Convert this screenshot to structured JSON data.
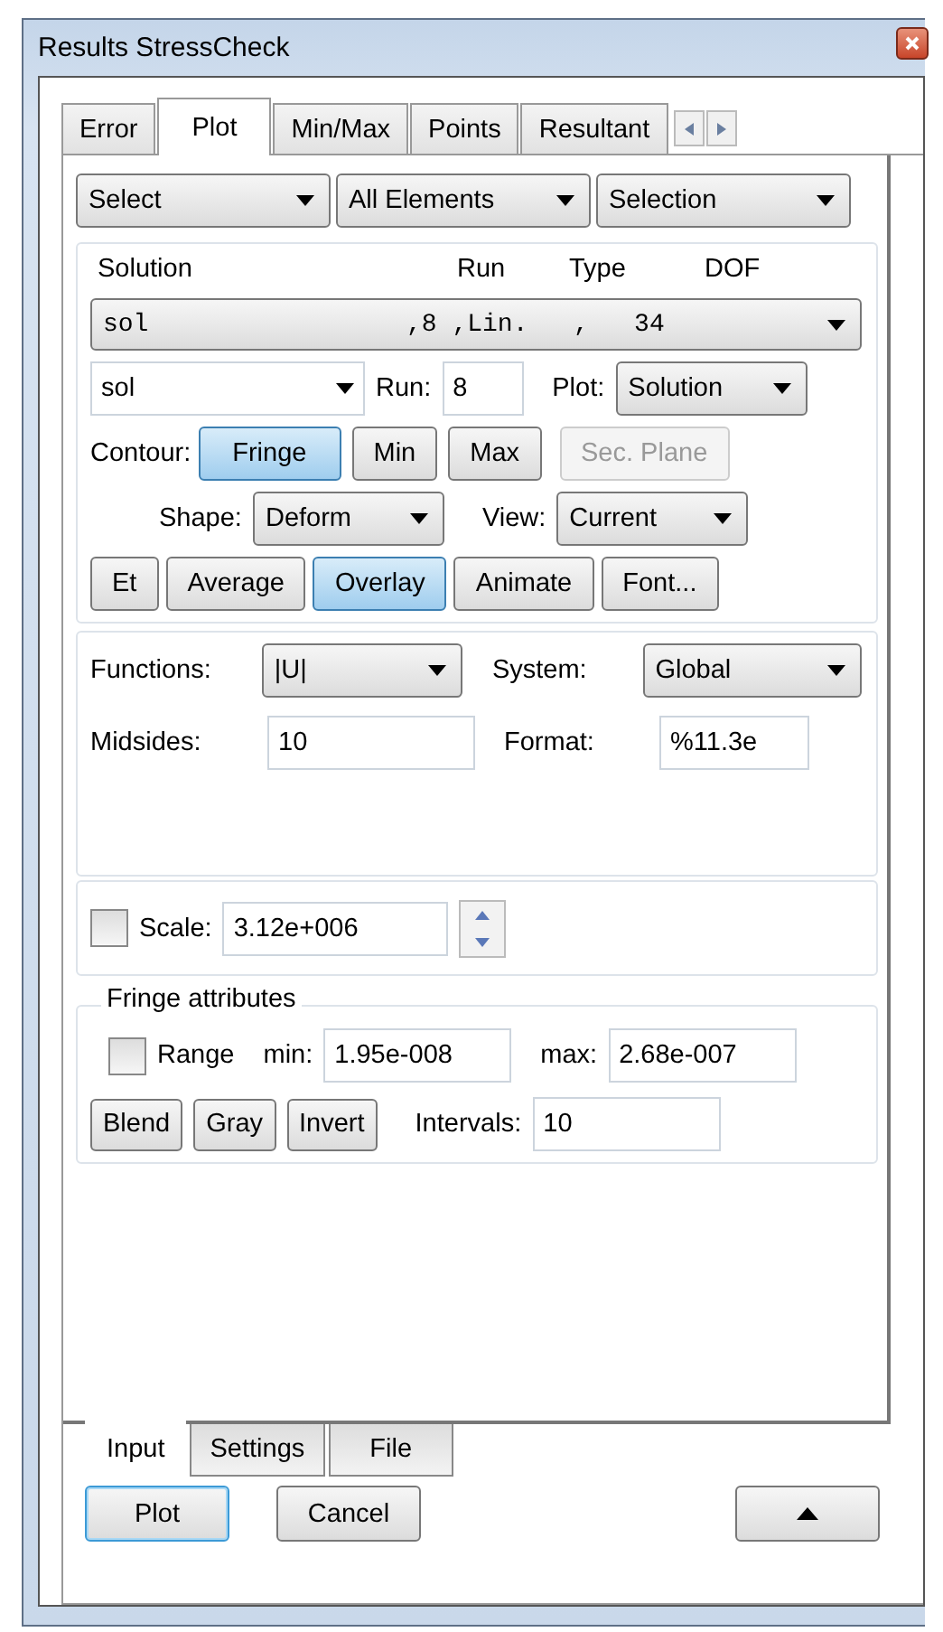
{
  "window": {
    "title": "Results StressCheck"
  },
  "tabs": [
    {
      "label": "Error",
      "selected": false
    },
    {
      "label": "Plot",
      "selected": true
    },
    {
      "label": "Min/Max",
      "selected": false
    },
    {
      "label": "Points",
      "selected": false
    },
    {
      "label": "Resultant",
      "selected": false
    }
  ],
  "selectors": [
    "Select",
    "All Elements",
    "Selection"
  ],
  "solution": {
    "headers": [
      "Solution",
      "Run",
      "Type",
      "DOF"
    ],
    "combo": "sol                 ,8 ,Lin.   ,   34",
    "name": "sol",
    "run_label": "Run:",
    "run": "8",
    "plot_label": "Plot:",
    "plot": "Solution"
  },
  "contour": {
    "label": "Contour:",
    "buttons": [
      {
        "label": "Fringe",
        "selected": true,
        "disabled": false
      },
      {
        "label": "Min",
        "selected": false,
        "disabled": false
      },
      {
        "label": "Max",
        "selected": false,
        "disabled": false
      },
      {
        "label": "Sec. Plane",
        "selected": false,
        "disabled": true
      }
    ]
  },
  "shape": {
    "label": "Shape:",
    "value": "Deform"
  },
  "view": {
    "label": "View:",
    "value": "Current"
  },
  "options": [
    {
      "label": "Et",
      "selected": false
    },
    {
      "label": "Average",
      "selected": false
    },
    {
      "label": "Overlay",
      "selected": true
    },
    {
      "label": "Animate",
      "selected": false
    },
    {
      "label": "Font...",
      "selected": false
    }
  ],
  "functions": {
    "label": "Functions:",
    "value": "|U|"
  },
  "system": {
    "label": "System:",
    "value": "Global"
  },
  "midsides": {
    "label": "Midsides:",
    "value": "10"
  },
  "format": {
    "label": "Format:",
    "value": "%11.3e"
  },
  "scale": {
    "checked": false,
    "label": "Scale:",
    "value": "3.12e+006"
  },
  "fringe": {
    "title": "Fringe attributes",
    "range_checked": false,
    "range_label": "Range",
    "min_label": "min:",
    "min": "1.95e-008",
    "max_label": "max:",
    "max": "2.68e-007",
    "buttons": [
      "Blend",
      "Gray",
      "Invert"
    ],
    "intervals_label": "Intervals:",
    "intervals": "10"
  },
  "bottom_tabs": [
    {
      "label": "Input",
      "selected": true
    },
    {
      "label": "Settings",
      "selected": false
    },
    {
      "label": "File",
      "selected": false
    }
  ],
  "actions": [
    {
      "label": "Plot",
      "default": true
    },
    {
      "label": "Cancel",
      "default": false
    }
  ]
}
